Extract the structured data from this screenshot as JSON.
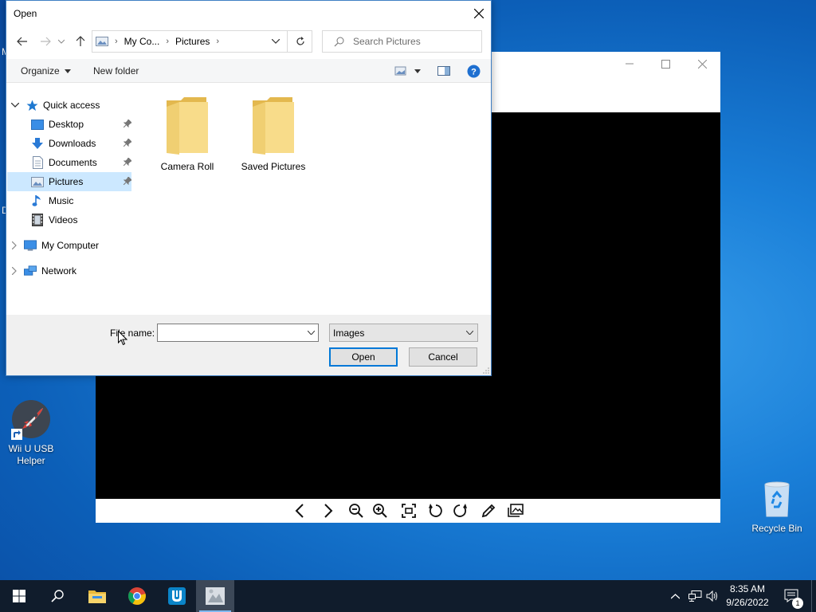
{
  "desktop": {
    "icons": [
      {
        "label": "Wii U USB Helper"
      },
      {
        "label": "Recycle Bin"
      }
    ],
    "edge_letters": [
      "M",
      "D"
    ]
  },
  "viewer": {
    "toolbar_icons": [
      "chevron-left",
      "chevron-right",
      "zoom-out",
      "zoom-in",
      "fit-to-window",
      "rotate-left",
      "rotate-right",
      "edit",
      "gallery"
    ]
  },
  "dialog": {
    "title": "Open",
    "address": {
      "crumbs": [
        "My Co...",
        "Pictures"
      ]
    },
    "search_placeholder": "Search Pictures",
    "commands": {
      "organize": "Organize",
      "new_folder": "New folder"
    },
    "nav": {
      "quick_access": "Quick access",
      "items": [
        {
          "label": "Desktop",
          "pinned": true
        },
        {
          "label": "Downloads",
          "pinned": true
        },
        {
          "label": "Documents",
          "pinned": true
        },
        {
          "label": "Pictures",
          "pinned": true,
          "selected": true
        },
        {
          "label": "Music",
          "pinned": false
        },
        {
          "label": "Videos",
          "pinned": false
        }
      ],
      "my_computer": "My Computer",
      "network": "Network"
    },
    "folders": [
      {
        "label": "Camera Roll"
      },
      {
        "label": "Saved Pictures"
      }
    ],
    "file_name_label": "File name:",
    "file_name_value": "",
    "file_type": "Images",
    "open_label": "Open",
    "cancel_label": "Cancel"
  },
  "taskbar": {
    "time": "8:35 AM",
    "date": "9/26/2022",
    "notification_count": "1"
  },
  "colors": {
    "accent": "#0078d7",
    "selection": "#cce8ff",
    "taskbar": "#101c2c",
    "folder": "#f4cf6a"
  }
}
